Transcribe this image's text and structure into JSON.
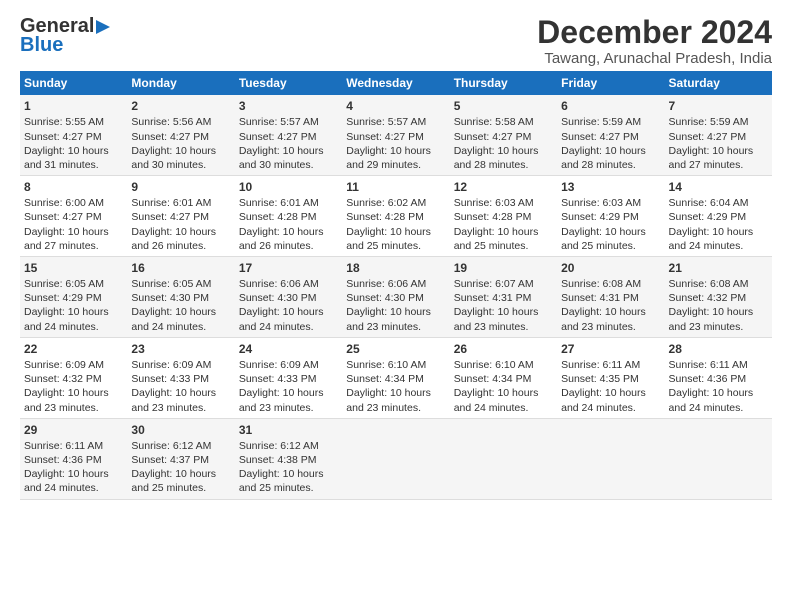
{
  "logo": {
    "line1": "General",
    "line2": "Blue"
  },
  "title": "December 2024",
  "subtitle": "Tawang, Arunachal Pradesh, India",
  "days_header": [
    "Sunday",
    "Monday",
    "Tuesday",
    "Wednesday",
    "Thursday",
    "Friday",
    "Saturday"
  ],
  "weeks": [
    [
      {
        "day": "1",
        "sunrise": "Sunrise: 5:55 AM",
        "sunset": "Sunset: 4:27 PM",
        "daylight": "Daylight: 10 hours and 31 minutes."
      },
      {
        "day": "2",
        "sunrise": "Sunrise: 5:56 AM",
        "sunset": "Sunset: 4:27 PM",
        "daylight": "Daylight: 10 hours and 30 minutes."
      },
      {
        "day": "3",
        "sunrise": "Sunrise: 5:57 AM",
        "sunset": "Sunset: 4:27 PM",
        "daylight": "Daylight: 10 hours and 30 minutes."
      },
      {
        "day": "4",
        "sunrise": "Sunrise: 5:57 AM",
        "sunset": "Sunset: 4:27 PM",
        "daylight": "Daylight: 10 hours and 29 minutes."
      },
      {
        "day": "5",
        "sunrise": "Sunrise: 5:58 AM",
        "sunset": "Sunset: 4:27 PM",
        "daylight": "Daylight: 10 hours and 28 minutes."
      },
      {
        "day": "6",
        "sunrise": "Sunrise: 5:59 AM",
        "sunset": "Sunset: 4:27 PM",
        "daylight": "Daylight: 10 hours and 28 minutes."
      },
      {
        "day": "7",
        "sunrise": "Sunrise: 5:59 AM",
        "sunset": "Sunset: 4:27 PM",
        "daylight": "Daylight: 10 hours and 27 minutes."
      }
    ],
    [
      {
        "day": "8",
        "sunrise": "Sunrise: 6:00 AM",
        "sunset": "Sunset: 4:27 PM",
        "daylight": "Daylight: 10 hours and 27 minutes."
      },
      {
        "day": "9",
        "sunrise": "Sunrise: 6:01 AM",
        "sunset": "Sunset: 4:27 PM",
        "daylight": "Daylight: 10 hours and 26 minutes."
      },
      {
        "day": "10",
        "sunrise": "Sunrise: 6:01 AM",
        "sunset": "Sunset: 4:28 PM",
        "daylight": "Daylight: 10 hours and 26 minutes."
      },
      {
        "day": "11",
        "sunrise": "Sunrise: 6:02 AM",
        "sunset": "Sunset: 4:28 PM",
        "daylight": "Daylight: 10 hours and 25 minutes."
      },
      {
        "day": "12",
        "sunrise": "Sunrise: 6:03 AM",
        "sunset": "Sunset: 4:28 PM",
        "daylight": "Daylight: 10 hours and 25 minutes."
      },
      {
        "day": "13",
        "sunrise": "Sunrise: 6:03 AM",
        "sunset": "Sunset: 4:29 PM",
        "daylight": "Daylight: 10 hours and 25 minutes."
      },
      {
        "day": "14",
        "sunrise": "Sunrise: 6:04 AM",
        "sunset": "Sunset: 4:29 PM",
        "daylight": "Daylight: 10 hours and 24 minutes."
      }
    ],
    [
      {
        "day": "15",
        "sunrise": "Sunrise: 6:05 AM",
        "sunset": "Sunset: 4:29 PM",
        "daylight": "Daylight: 10 hours and 24 minutes."
      },
      {
        "day": "16",
        "sunrise": "Sunrise: 6:05 AM",
        "sunset": "Sunset: 4:30 PM",
        "daylight": "Daylight: 10 hours and 24 minutes."
      },
      {
        "day": "17",
        "sunrise": "Sunrise: 6:06 AM",
        "sunset": "Sunset: 4:30 PM",
        "daylight": "Daylight: 10 hours and 24 minutes."
      },
      {
        "day": "18",
        "sunrise": "Sunrise: 6:06 AM",
        "sunset": "Sunset: 4:30 PM",
        "daylight": "Daylight: 10 hours and 23 minutes."
      },
      {
        "day": "19",
        "sunrise": "Sunrise: 6:07 AM",
        "sunset": "Sunset: 4:31 PM",
        "daylight": "Daylight: 10 hours and 23 minutes."
      },
      {
        "day": "20",
        "sunrise": "Sunrise: 6:08 AM",
        "sunset": "Sunset: 4:31 PM",
        "daylight": "Daylight: 10 hours and 23 minutes."
      },
      {
        "day": "21",
        "sunrise": "Sunrise: 6:08 AM",
        "sunset": "Sunset: 4:32 PM",
        "daylight": "Daylight: 10 hours and 23 minutes."
      }
    ],
    [
      {
        "day": "22",
        "sunrise": "Sunrise: 6:09 AM",
        "sunset": "Sunset: 4:32 PM",
        "daylight": "Daylight: 10 hours and 23 minutes."
      },
      {
        "day": "23",
        "sunrise": "Sunrise: 6:09 AM",
        "sunset": "Sunset: 4:33 PM",
        "daylight": "Daylight: 10 hours and 23 minutes."
      },
      {
        "day": "24",
        "sunrise": "Sunrise: 6:09 AM",
        "sunset": "Sunset: 4:33 PM",
        "daylight": "Daylight: 10 hours and 23 minutes."
      },
      {
        "day": "25",
        "sunrise": "Sunrise: 6:10 AM",
        "sunset": "Sunset: 4:34 PM",
        "daylight": "Daylight: 10 hours and 23 minutes."
      },
      {
        "day": "26",
        "sunrise": "Sunrise: 6:10 AM",
        "sunset": "Sunset: 4:34 PM",
        "daylight": "Daylight: 10 hours and 24 minutes."
      },
      {
        "day": "27",
        "sunrise": "Sunrise: 6:11 AM",
        "sunset": "Sunset: 4:35 PM",
        "daylight": "Daylight: 10 hours and 24 minutes."
      },
      {
        "day": "28",
        "sunrise": "Sunrise: 6:11 AM",
        "sunset": "Sunset: 4:36 PM",
        "daylight": "Daylight: 10 hours and 24 minutes."
      }
    ],
    [
      {
        "day": "29",
        "sunrise": "Sunrise: 6:11 AM",
        "sunset": "Sunset: 4:36 PM",
        "daylight": "Daylight: 10 hours and 24 minutes."
      },
      {
        "day": "30",
        "sunrise": "Sunrise: 6:12 AM",
        "sunset": "Sunset: 4:37 PM",
        "daylight": "Daylight: 10 hours and 25 minutes."
      },
      {
        "day": "31",
        "sunrise": "Sunrise: 6:12 AM",
        "sunset": "Sunset: 4:38 PM",
        "daylight": "Daylight: 10 hours and 25 minutes."
      },
      {
        "day": "",
        "sunrise": "",
        "sunset": "",
        "daylight": ""
      },
      {
        "day": "",
        "sunrise": "",
        "sunset": "",
        "daylight": ""
      },
      {
        "day": "",
        "sunrise": "",
        "sunset": "",
        "daylight": ""
      },
      {
        "day": "",
        "sunrise": "",
        "sunset": "",
        "daylight": ""
      }
    ]
  ]
}
